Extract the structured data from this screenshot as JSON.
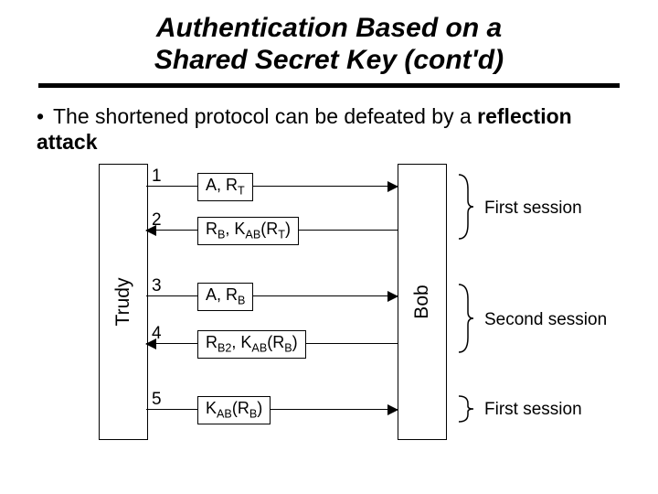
{
  "title_line1": "Authentication Based on a",
  "title_line2": "Shared Secret Key (cont'd)",
  "bullet_text_a": "The shortened protocol can be defeated by a ",
  "bullet_text_b": "reflection attack",
  "principals": {
    "left": "Trudy",
    "right": "Bob"
  },
  "messages": [
    {
      "num": "1",
      "dir": "right",
      "label_html": "A, R<sub>T</sub>"
    },
    {
      "num": "2",
      "dir": "left",
      "label_html": "R<sub>B</sub>, K<sub>AB</sub>(R<sub>T</sub>)"
    },
    {
      "num": "3",
      "dir": "right",
      "label_html": "A, R<sub>B</sub>"
    },
    {
      "num": "4",
      "dir": "left",
      "label_html": "R<sub>B2</sub>, K<sub>AB</sub>(R<sub>B</sub>)"
    },
    {
      "num": "5",
      "dir": "right",
      "label_html": "K<sub>AB</sub>(R<sub>B</sub>)"
    }
  ],
  "sessions": [
    {
      "label": "First session"
    },
    {
      "label": "Second session"
    },
    {
      "label": "First session"
    }
  ]
}
